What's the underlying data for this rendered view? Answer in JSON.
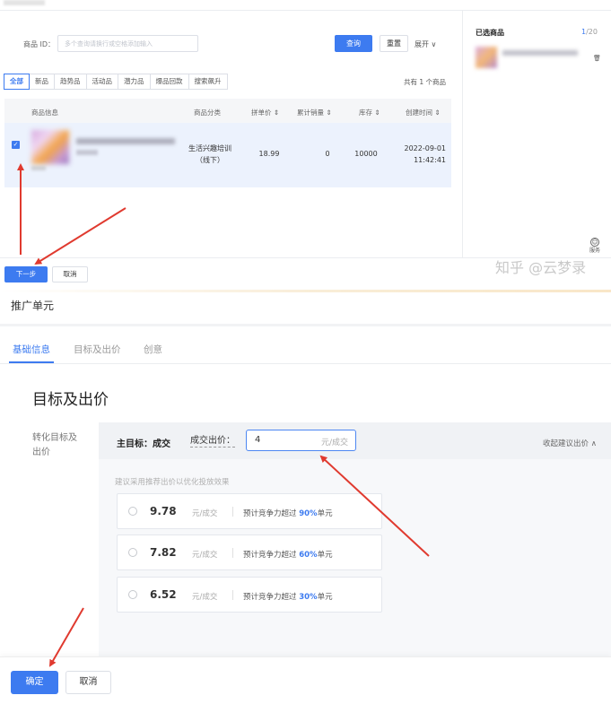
{
  "top": {
    "filter": {
      "label": "商品 ID：",
      "placeholder": "多个查询请换行或空格添加输入",
      "query_button": "查询",
      "reset_button": "重置",
      "expand_button": "展开 ∨"
    },
    "tabs": [
      "全部",
      "新品",
      "趋势品",
      "活动品",
      "潜力品",
      "爆品回款",
      "搜索飙升"
    ],
    "result_count": "共有 1 个商品",
    "table": {
      "headers": [
        "商品信息",
        "商品分类",
        "拼单价 ⇕",
        "累计销量 ⇕",
        "库存 ⇕",
        "创建时间 ⇕"
      ],
      "row": {
        "category_line1": "生活兴趣培训",
        "category_line2": "（线下）",
        "price": "18.99",
        "sales": "0",
        "stock": "10000",
        "created_date": "2022-09-01",
        "created_time": "11:42:41"
      }
    },
    "sidebar": {
      "title": "已选商品",
      "count_selected": "1",
      "count_total": "/20"
    },
    "service_label": "服务",
    "next_button": "下一步",
    "cancel_button": "取消",
    "watermark": "知乎 @云梦录"
  },
  "bottom": {
    "unit_title": "推广单元",
    "steps": [
      "基础信息",
      "目标及出价",
      "创意"
    ],
    "section_title": "目标及出价",
    "field_label_line1": "转化目标及",
    "field_label_line2": "出价",
    "main_goal": "主目标：成交",
    "bid_label": "成交出价：",
    "bid_value": "4",
    "bid_unit": "元/成交",
    "collapse_label": "收起建议出价 ∧",
    "hint": "建议采用推荐出价以优化投放效果",
    "options": [
      {
        "price": "9.78",
        "unit": "元/成交",
        "desc_prefix": "预计竞争力超过 ",
        "percent": "90%",
        "desc_suffix": "单元"
      },
      {
        "price": "7.82",
        "unit": "元/成交",
        "desc_prefix": "预计竞争力超过 ",
        "percent": "60%",
        "desc_suffix": "单元"
      },
      {
        "price": "6.52",
        "unit": "元/成交",
        "desc_prefix": "预计竞争力超过 ",
        "percent": "30%",
        "desc_suffix": "单元"
      }
    ],
    "confirm_button": "确定",
    "cancel_button": "取消"
  },
  "colors": {
    "accent": "#3d7bf0",
    "annotation_arrow": "#e03a2f",
    "selected_row": "#ecf2fd"
  }
}
